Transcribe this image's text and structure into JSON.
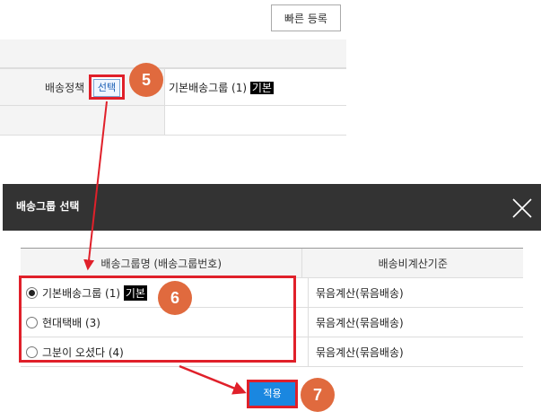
{
  "toolbar": {
    "quick_register": "빠른 등록"
  },
  "form": {
    "policy_label": "배송정책",
    "select_label": "선택",
    "group_name": "기본배송그룹 (1)",
    "group_tag": "기본"
  },
  "modal": {
    "title": "배송그룹 선택",
    "columns": [
      "배송그룹명 (배송그룹번호)",
      "배송비계산기준"
    ],
    "rows": [
      {
        "name": "기본배송그룹 (1)",
        "tag": "기본",
        "calc": "묶음계산(묶음배송)",
        "selected": true
      },
      {
        "name": "현대택배 (3)",
        "tag": "",
        "calc": "묶음계산(묶음배송)",
        "selected": false
      },
      {
        "name": "그분이 오셨다 (4)",
        "tag": "",
        "calc": "묶음계산(묶음배송)",
        "selected": false
      }
    ],
    "apply_label": "적용"
  },
  "badges": [
    "5",
    "6",
    "7"
  ],
  "colors": {
    "highlight_red": "#e0202a",
    "badge_orange": "#e06a3e",
    "apply_blue": "#1a87e0",
    "modal_header": "#333333"
  }
}
